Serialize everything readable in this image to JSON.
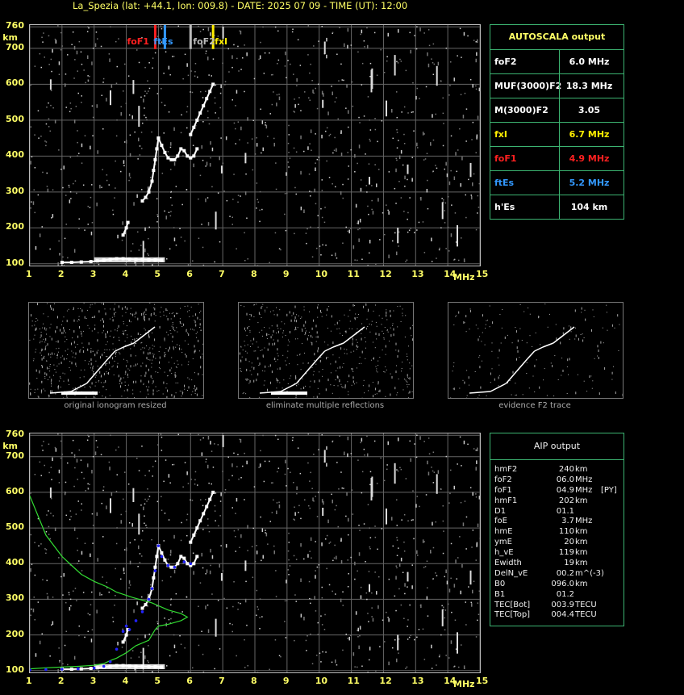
{
  "header": {
    "title": "La_Spezia (lat: +44.1, lon: 009.8) - DATE: 2025 07 09 - TIME (UT): 12:00"
  },
  "colors": {
    "axis_label": "#ffff66",
    "grid": "#666666",
    "foF1": "#ff2020",
    "ftEs": "#3399ff",
    "fxI": "#ffee00",
    "profile": "#33dd33",
    "trace_fit": "#2222ff",
    "panel_border": "#3cb371"
  },
  "axes": {
    "x_unit": "MHz",
    "y_unit": "km",
    "x_ticks": [
      "1",
      "2",
      "3",
      "4",
      "5",
      "6",
      "7",
      "8",
      "9",
      "10",
      "11",
      "12",
      "13",
      "14",
      "15"
    ],
    "y_ticks": [
      "760",
      "700",
      "600",
      "500",
      "400",
      "300",
      "200",
      "100"
    ]
  },
  "markers": {
    "foF1": {
      "label": "foF1",
      "value": 4.9,
      "color": "#ff2020"
    },
    "ftEs": {
      "label": "ftEs",
      "value": 5.2,
      "color": "#3399ff"
    },
    "foF2": {
      "label": "foF2",
      "value": 6.0,
      "color": "#bbbbbb"
    },
    "fxI": {
      "label": "fxI",
      "value": 6.7,
      "color": "#ffee00"
    }
  },
  "autoscala": {
    "title": "AUTOSCALA output",
    "rows": [
      {
        "label": "foF2",
        "value": "6.0 MHz",
        "color": "#ffffff"
      },
      {
        "label": "MUF(3000)F2",
        "value": "18.3 MHz",
        "color": "#ffffff"
      },
      {
        "label": "M(3000)F2",
        "value": "3.05",
        "color": "#ffffff"
      },
      {
        "label": "fxI",
        "value": "6.7 MHz",
        "color": "#ffee00"
      },
      {
        "label": "foF1",
        "value": "4.9 MHz",
        "color": "#ff2020"
      },
      {
        "label": "ftEs",
        "value": "5.2 MHz",
        "color": "#3399ff"
      },
      {
        "label": "h'Es",
        "value": "104     km",
        "color": "#ffffff"
      }
    ]
  },
  "thumbnails": [
    {
      "caption": "original ionogram resized"
    },
    {
      "caption": "eliminate multiple reflections"
    },
    {
      "caption": "evidence F2 trace"
    }
  ],
  "aip": {
    "title": "AIP output",
    "rows": [
      {
        "name": "hmF2",
        "value": "240",
        "unit": "km",
        "extra": ""
      },
      {
        "name": "foF2",
        "value": "06.0",
        "unit": "MHz",
        "extra": ""
      },
      {
        "name": "foF1",
        "value": "04.9",
        "unit": "MHz",
        "extra": "[PY]"
      },
      {
        "name": "hmF1",
        "value": "202",
        "unit": "km",
        "extra": ""
      },
      {
        "name": "D1",
        "value": "01.1",
        "unit": "",
        "extra": ""
      },
      {
        "name": "foE",
        "value": "3.7",
        "unit": "MHz",
        "extra": ""
      },
      {
        "name": "hmE",
        "value": "110",
        "unit": "km",
        "extra": ""
      },
      {
        "name": "ymE",
        "value": "20",
        "unit": "km",
        "extra": ""
      },
      {
        "name": "h_vE",
        "value": "119",
        "unit": "km",
        "extra": ""
      },
      {
        "name": "Ewidth",
        "value": "19",
        "unit": "km",
        "extra": ""
      },
      {
        "name": "DelN_vE",
        "value": "00.2",
        "unit": "m^(-3)",
        "extra": ""
      },
      {
        "name": "B0",
        "value": "096.0",
        "unit": "km",
        "extra": ""
      },
      {
        "name": "B1",
        "value": "01.2",
        "unit": "",
        "extra": ""
      },
      {
        "name": "TEC[Bot]",
        "value": "003.9",
        "unit": "TECU",
        "extra": ""
      },
      {
        "name": "TEC[Top]",
        "value": "004.4",
        "unit": "TECU",
        "extra": ""
      }
    ]
  },
  "chart_data": [
    {
      "type": "scatter",
      "title": "",
      "xlabel": "MHz",
      "ylabel": "km",
      "xlim": [
        1,
        15
      ],
      "ylim": [
        95,
        765
      ],
      "x_ticks": [
        1,
        2,
        3,
        4,
        5,
        6,
        7,
        8,
        9,
        10,
        11,
        12,
        13,
        14,
        15
      ],
      "y_ticks": [
        100,
        200,
        300,
        400,
        500,
        600,
        700,
        760
      ],
      "grid": true,
      "series": [
        {
          "x": [
            2.0,
            2.3,
            2.6,
            2.9,
            3.1,
            3.3,
            3.5,
            3.7,
            3.9,
            4.1,
            4.3,
            4.5,
            4.7,
            4.9,
            5.1
          ],
          "y": [
            104,
            104,
            105,
            106,
            108,
            110,
            112,
            114,
            114,
            113,
            112,
            112,
            111,
            111,
            110
          ]
        },
        {
          "x": [
            3.9,
            4.0,
            4.05
          ],
          "y": [
            180,
            200,
            215
          ]
        },
        {
          "x": [
            4.5,
            4.6,
            4.7,
            4.8,
            4.85,
            4.9,
            4.95,
            5.0
          ],
          "y": [
            275,
            285,
            300,
            330,
            360,
            390,
            420,
            450
          ]
        },
        {
          "x": [
            5.0,
            5.1,
            5.2,
            5.3,
            5.4,
            5.5,
            5.6,
            5.7,
            5.8,
            5.9,
            6.0,
            6.1,
            6.2
          ],
          "y": [
            450,
            430,
            410,
            395,
            390,
            390,
            400,
            420,
            415,
            400,
            395,
            400,
            420
          ]
        },
        {
          "x": [
            6.0,
            6.1,
            6.2,
            6.3,
            6.4,
            6.5,
            6.6,
            6.7
          ],
          "y": [
            460,
            480,
            500,
            520,
            540,
            560,
            580,
            600
          ]
        }
      ],
      "fitted_trace": {
        "x": [
          1.0,
          1.5,
          2.0,
          2.5,
          3.0,
          3.3,
          3.5,
          3.7,
          3.9,
          4.0,
          4.1,
          4.3,
          4.5,
          4.7,
          4.8,
          4.9,
          5.0,
          5.1,
          5.3,
          5.5,
          5.8,
          6.0
        ],
        "y": [
          102,
          103,
          104,
          105,
          107,
          112,
          125,
          160,
          210,
          225,
          215,
          240,
          265,
          300,
          330,
          380,
          450,
          420,
          395,
          390,
          405,
          400
        ]
      },
      "profile": {
        "x": [
          1.0,
          1.5,
          2.0,
          2.3,
          2.6,
          3.0,
          3.4,
          3.7,
          4.2,
          4.8,
          5.3,
          5.7,
          5.9,
          5.7,
          5.3,
          5.0,
          4.9,
          4.7,
          4.3,
          4.0,
          3.7,
          3.5,
          3.3,
          3.0,
          2.5,
          2.0,
          1.5,
          1.0
        ],
        "y": [
          590,
          480,
          420,
          395,
          370,
          350,
          335,
          320,
          305,
          290,
          270,
          260,
          250,
          240,
          230,
          225,
          215,
          185,
          170,
          150,
          135,
          128,
          120,
          115,
          112,
          110,
          108,
          105
        ]
      }
    }
  ]
}
